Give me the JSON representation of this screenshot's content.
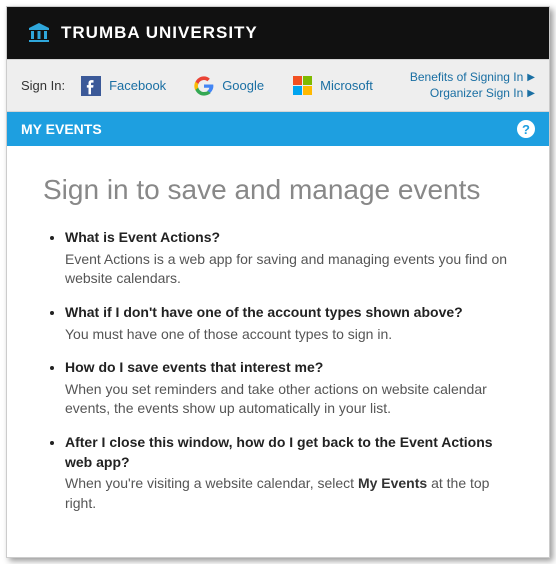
{
  "header": {
    "brand": "TRUMBA UNIVERSITY"
  },
  "signin": {
    "label": "Sign In:",
    "providers": [
      {
        "id": "facebook",
        "label": "Facebook"
      },
      {
        "id": "google",
        "label": "Google"
      },
      {
        "id": "microsoft",
        "label": "Microsoft"
      }
    ],
    "right_links": {
      "benefits": "Benefits of Signing In",
      "organizer": "Organizer Sign In"
    }
  },
  "bluebar": {
    "title": "MY EVENTS",
    "help_glyph": "?"
  },
  "main": {
    "headline": "Sign in to save and manage events",
    "faq": [
      {
        "q": "What is Event Actions?",
        "a": "Event Actions is a web app for saving and managing events you find on website calendars."
      },
      {
        "q": "What if I don't have one of the account types shown above?",
        "a": "You must have one of those account types to sign in."
      },
      {
        "q": "How do I save events that interest me?",
        "a": "When you set reminders and take other actions on website calendar events, the events show up automatically in your list."
      },
      {
        "q": "After I close this window, how do I get back to the Event Actions web app?",
        "a_pre": "When you're visiting a website calendar, select ",
        "a_bold": "My Events",
        "a_post": " at the top right."
      }
    ]
  }
}
